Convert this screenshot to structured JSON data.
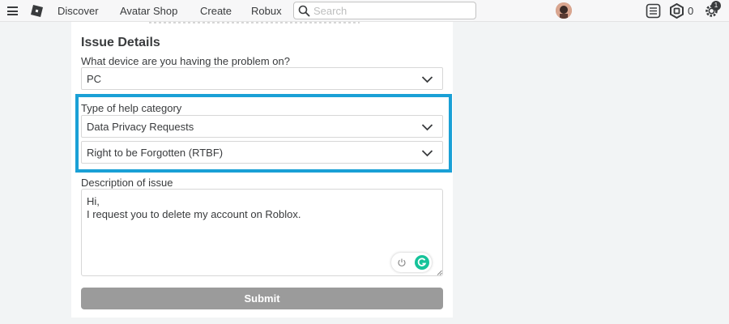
{
  "nav": {
    "items": [
      "Discover",
      "Avatar Shop",
      "Create",
      "Robux"
    ],
    "search_placeholder": "Search",
    "robux_balance": "0",
    "notification_count": "1"
  },
  "form": {
    "title": "Issue Details",
    "device_label": "What device are you having the problem on?",
    "device_value": "PC",
    "category_label": "Type of help category",
    "category_value": "Data Privacy Requests",
    "subcategory_value": "Right to be Forgotten (RTBF)",
    "description_label": "Description of issue",
    "description_value": "Hi,\nI request you to delete my account on Roblox.",
    "submit_label": "Submit"
  },
  "colors": {
    "highlight": "#1aa0d6",
    "submit_disabled": "#9b9b9b",
    "grammarly": "#15c39a"
  }
}
